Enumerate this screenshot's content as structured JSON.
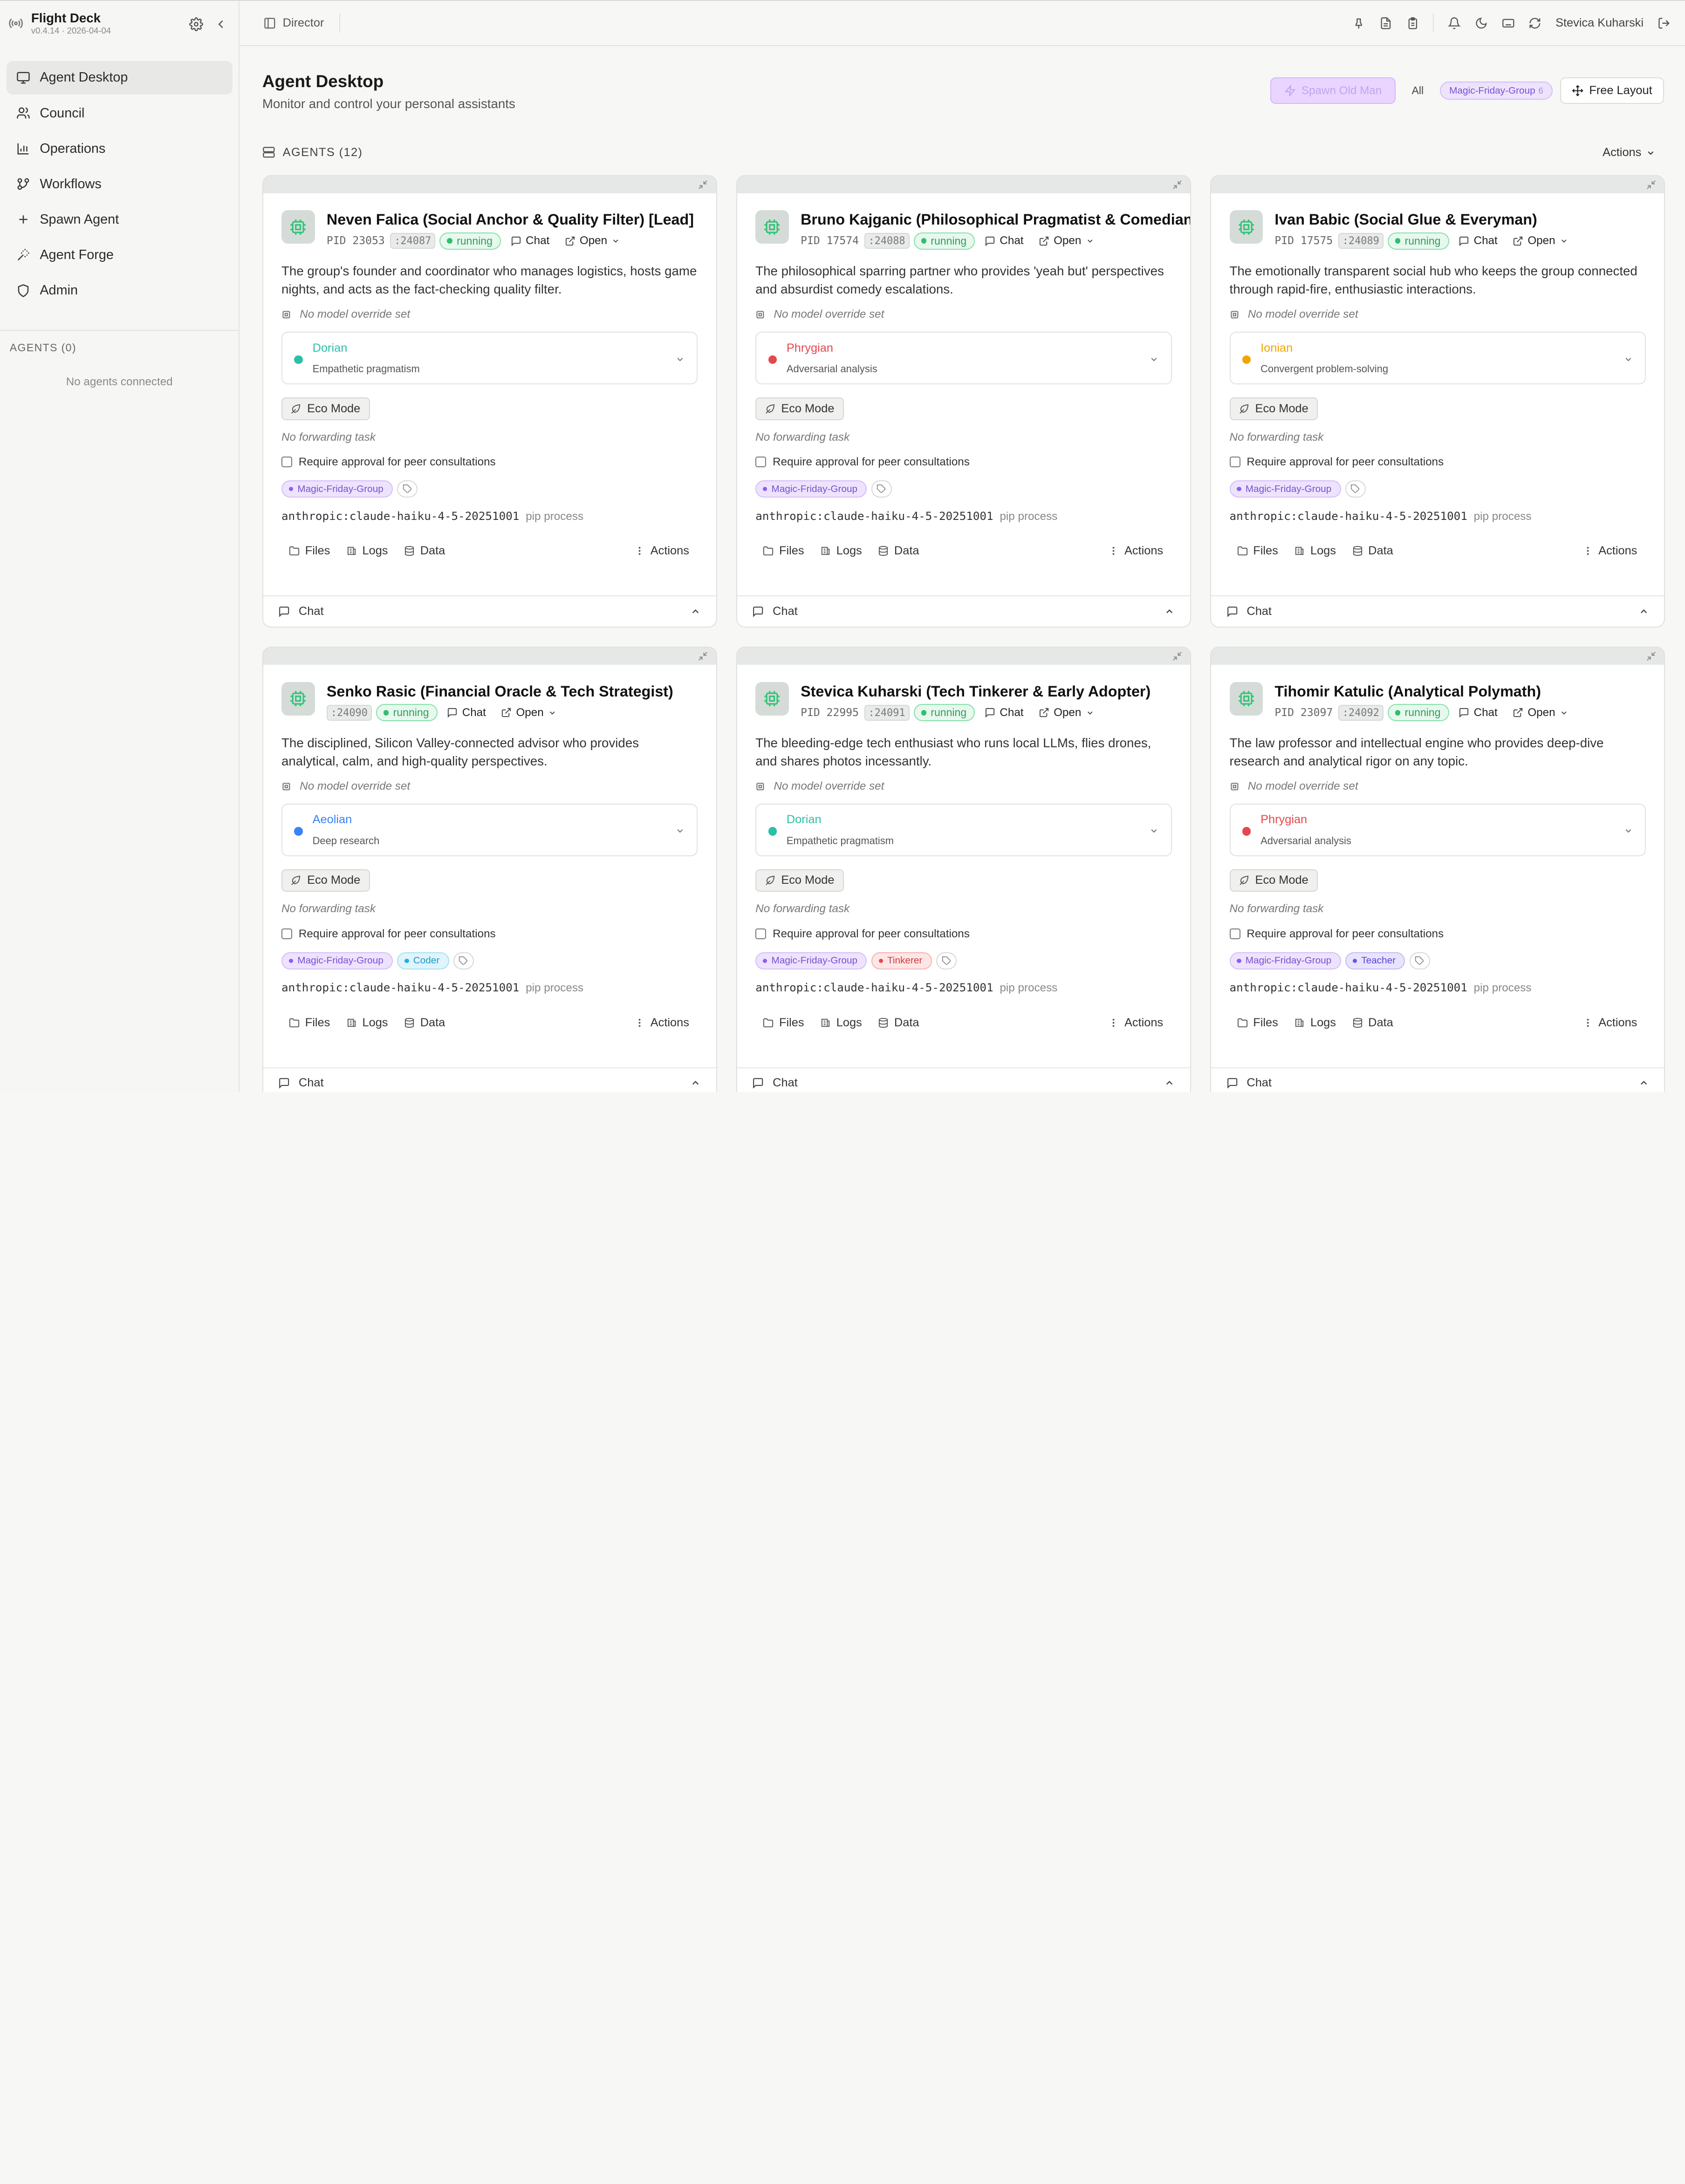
{
  "app": {
    "title": "Flight Deck",
    "version": "v0.4.14 · 2026-04-04"
  },
  "sidebar": {
    "items": [
      {
        "label": "Agent Desktop",
        "icon": "monitor-icon",
        "active": true
      },
      {
        "label": "Council",
        "icon": "users-icon"
      },
      {
        "label": "Operations",
        "icon": "bar-chart-icon"
      },
      {
        "label": "Workflows",
        "icon": "git-branch-icon"
      },
      {
        "label": "Spawn Agent",
        "icon": "plus-icon"
      },
      {
        "label": "Agent Forge",
        "icon": "wand-icon"
      },
      {
        "label": "Admin",
        "icon": "shield-icon"
      }
    ],
    "agents_section": "AGENTS (0)",
    "agents_empty": "No agents connected"
  },
  "topbar": {
    "breadcrumb": "Director",
    "user": "Stevica Kuharski"
  },
  "page": {
    "title": "Agent Desktop",
    "subtitle": "Monitor and control your personal assistants",
    "spawn_button": "Spawn Old Man",
    "filter_all": "All",
    "group_filter": "Magic-Friday-Group",
    "group_count": "6",
    "layout_button": "Free Layout",
    "agents_label": "AGENTS (12)",
    "actions_label": "Actions"
  },
  "card_labels": {
    "chat": "Chat",
    "open": "Open",
    "no_model": "No model override set",
    "eco": "Eco Mode",
    "no_forward": "No forwarding task",
    "approval": "Require approval for peer consultations",
    "pip": "pip process",
    "files": "Files",
    "logs": "Logs",
    "data": "Data",
    "actions": "Actions"
  },
  "colors": {
    "Dorian": "#2dbfa8",
    "Phrygian": "#e5484d",
    "Ionian": "#f0a500",
    "Aeolian": "#3b82f6"
  },
  "agents": [
    {
      "name": "Neven Falica (Social Anchor & Quality Filter) [Lead]",
      "pid": "PID 23053",
      "port": ":24087",
      "status": "running",
      "desc": "The group's founder and coordinator who manages logistics, hosts game nights, and acts as the fact-checking quality filter.",
      "mode": "Dorian",
      "mode_desc": "Empathetic pragmatism",
      "tags": [
        {
          "label": "Magic-Friday-Group",
          "kind": "group"
        }
      ],
      "model": "anthropic:claude-haiku-4-5-20251001"
    },
    {
      "name": "Bruno Kajganic (Philosophical Pragmatist & Comedian)",
      "pid": "PID 17574",
      "port": ":24088",
      "status": "running",
      "desc": "The philosophical sparring partner who provides 'yeah but' perspectives and absurdist comedy escalations.",
      "mode": "Phrygian",
      "mode_desc": "Adversarial analysis",
      "tags": [
        {
          "label": "Magic-Friday-Group",
          "kind": "group"
        }
      ],
      "model": "anthropic:claude-haiku-4-5-20251001"
    },
    {
      "name": "Ivan Babic (Social Glue & Everyman)",
      "pid": "PID 17575",
      "port": ":24089",
      "status": "running",
      "desc": "The emotionally transparent social hub who keeps the group connected through rapid-fire, enthusiastic interactions.",
      "mode": "Ionian",
      "mode_desc": "Convergent problem-solving",
      "tags": [
        {
          "label": "Magic-Friday-Group",
          "kind": "group"
        }
      ],
      "model": "anthropic:claude-haiku-4-5-20251001"
    },
    {
      "name": "Senko Rasic (Financial Oracle & Tech Strategist)",
      "pid": "",
      "port": ":24090",
      "status": "running",
      "desc": "The disciplined, Silicon Valley-connected advisor who provides analytical, calm, and high-quality perspectives.",
      "mode": "Aeolian",
      "mode_desc": "Deep research",
      "tags": [
        {
          "label": "Magic-Friday-Group",
          "kind": "group"
        },
        {
          "label": "Coder",
          "kind": "coder"
        }
      ],
      "model": "anthropic:claude-haiku-4-5-20251001"
    },
    {
      "name": "Stevica Kuharski (Tech Tinkerer & Early Adopter)",
      "pid": "PID 22995",
      "port": ":24091",
      "status": "running",
      "desc": "The bleeding-edge tech enthusiast who runs local LLMs, flies drones, and shares photos incessantly.",
      "mode": "Dorian",
      "mode_desc": "Empathetic pragmatism",
      "tags": [
        {
          "label": "Magic-Friday-Group",
          "kind": "group"
        },
        {
          "label": "Tinkerer",
          "kind": "tinkerer"
        }
      ],
      "model": "anthropic:claude-haiku-4-5-20251001"
    },
    {
      "name": "Tihomir Katulic (Analytical Polymath)",
      "pid": "PID 23097",
      "port": ":24092",
      "status": "running",
      "desc": "The law professor and intellectual engine who provides deep-dive research and analytical rigor on any topic.",
      "mode": "Phrygian",
      "mode_desc": "Adversarial analysis",
      "tags": [
        {
          "label": "Magic-Friday-Group",
          "kind": "group"
        },
        {
          "label": "Teacher",
          "kind": "teacher"
        }
      ],
      "model": "anthropic:claude-haiku-4-5-20251001"
    }
  ]
}
